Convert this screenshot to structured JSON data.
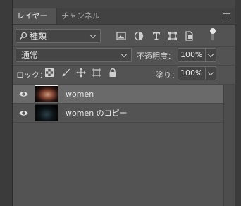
{
  "tabs": [
    {
      "label": "レイヤー",
      "active": true
    },
    {
      "label": "チャンネル",
      "active": false
    }
  ],
  "filter": {
    "kind_label": "種類",
    "icons": [
      "image-filter-icon",
      "adjustment-filter-icon",
      "type-filter-icon",
      "shape-filter-icon",
      "smart-object-filter-icon",
      "filter-toggle-icon"
    ]
  },
  "blend": {
    "mode": "通常",
    "opacity_label": "不透明度：",
    "opacity_value": "100%"
  },
  "lock": {
    "label": "ロック：",
    "icons": [
      "lock-transparent-pixels-icon",
      "lock-image-pixels-icon",
      "lock-position-icon",
      "lock-artboard-icon",
      "lock-all-icon"
    ],
    "fill_label": "塗り：",
    "fill_value": "100%"
  },
  "layers": [
    {
      "name": "women",
      "visible": true,
      "selected": true
    },
    {
      "name": "women のコピー",
      "visible": true,
      "selected": false
    }
  ],
  "colors": {
    "panel_bg": "#535353",
    "selected_row": "#6a6a6a",
    "tabbar_bg": "#424242"
  }
}
